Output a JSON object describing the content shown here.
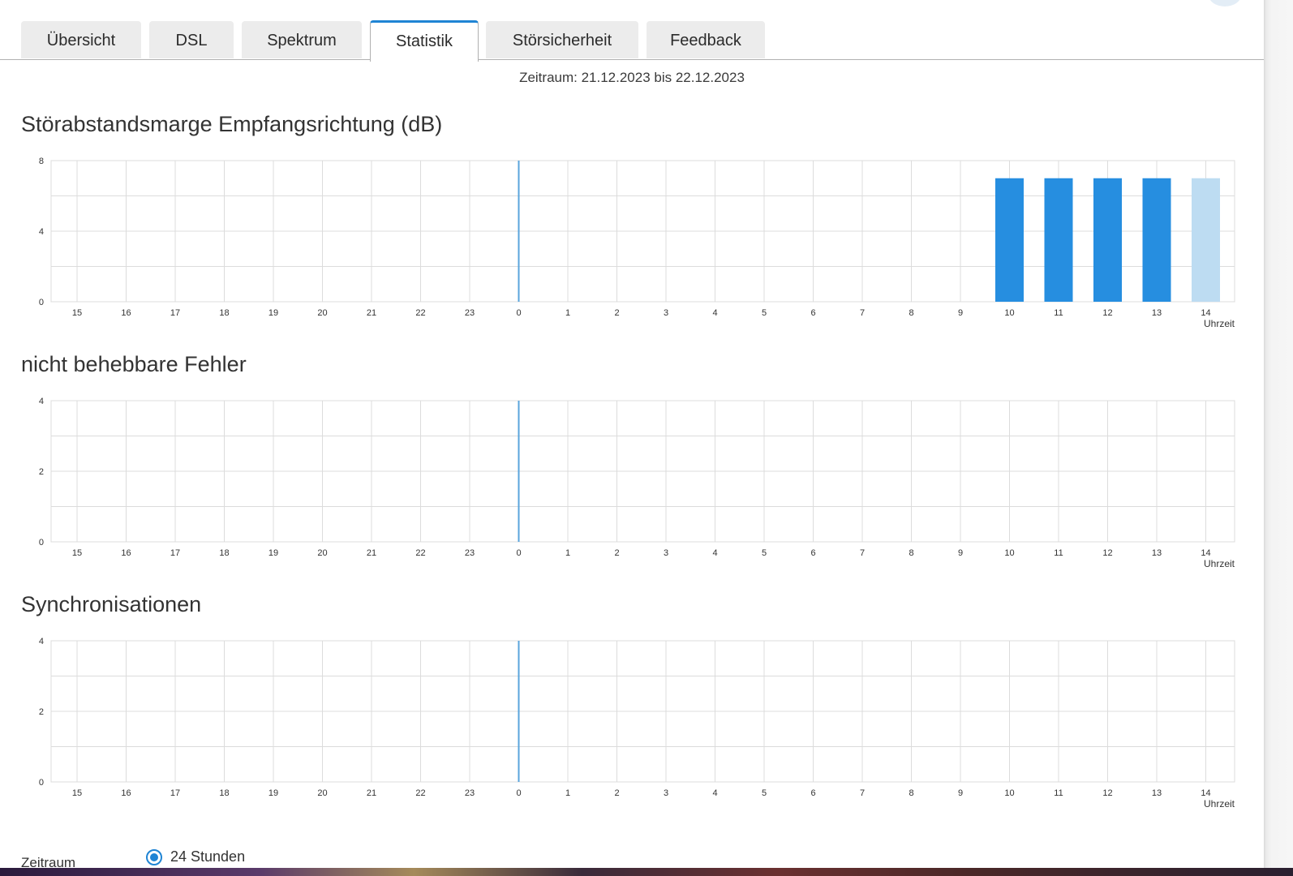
{
  "tabs": [
    {
      "label": "Übersicht",
      "active": false
    },
    {
      "label": "DSL",
      "active": false
    },
    {
      "label": "Spektrum",
      "active": false
    },
    {
      "label": "Statistik",
      "active": true
    },
    {
      "label": "Störsicherheit",
      "active": false
    },
    {
      "label": "Feedback",
      "active": false
    }
  ],
  "period_text": "Zeitraum: 21.12.2023 bis 22.12.2023",
  "colors": {
    "accent": "#1f84d4",
    "bar": "#268ee0",
    "bar_current": "#bddcf2",
    "grid": "#dcdcdc",
    "marker": "#5aa5dc"
  },
  "chart_data": [
    {
      "type": "bar",
      "title": "Störabstandsmarge Empfangsrichtung (dB)",
      "xlabel": "Uhrzeit",
      "categories": [
        "15",
        "16",
        "17",
        "18",
        "19",
        "20",
        "21",
        "22",
        "23",
        "0",
        "1",
        "2",
        "3",
        "4",
        "5",
        "6",
        "7",
        "8",
        "9",
        "10",
        "11",
        "12",
        "13",
        "14"
      ],
      "values": [
        null,
        null,
        null,
        null,
        null,
        null,
        null,
        null,
        null,
        null,
        null,
        null,
        null,
        null,
        null,
        null,
        null,
        null,
        null,
        7,
        7,
        7,
        7,
        7
      ],
      "current_index": 23,
      "ylim": [
        0,
        8
      ],
      "yticks": [
        0,
        4,
        8
      ],
      "day_marker": "0",
      "grid": true
    },
    {
      "type": "bar",
      "title": "nicht behebbare Fehler",
      "xlabel": "Uhrzeit",
      "categories": [
        "15",
        "16",
        "17",
        "18",
        "19",
        "20",
        "21",
        "22",
        "23",
        "0",
        "1",
        "2",
        "3",
        "4",
        "5",
        "6",
        "7",
        "8",
        "9",
        "10",
        "11",
        "12",
        "13",
        "14"
      ],
      "values": [],
      "ylim": [
        0,
        4
      ],
      "yticks": [
        0,
        2,
        4
      ],
      "day_marker": "0",
      "grid": true
    },
    {
      "type": "bar",
      "title": "Synchronisationen",
      "xlabel": "Uhrzeit",
      "categories": [
        "15",
        "16",
        "17",
        "18",
        "19",
        "20",
        "21",
        "22",
        "23",
        "0",
        "1",
        "2",
        "3",
        "4",
        "5",
        "6",
        "7",
        "8",
        "9",
        "10",
        "11",
        "12",
        "13",
        "14"
      ],
      "values": [],
      "ylim": [
        0,
        4
      ],
      "yticks": [
        0,
        2,
        4
      ],
      "day_marker": "0",
      "grid": true
    }
  ],
  "footer": {
    "label": "Zeitraum",
    "option": "24 Stunden"
  }
}
